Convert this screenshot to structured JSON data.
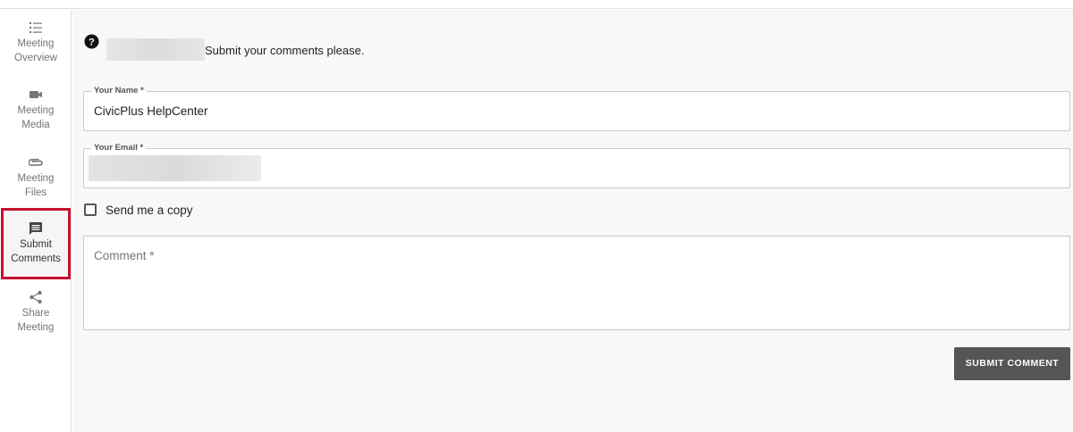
{
  "sidebar": {
    "items": [
      {
        "line1": "Meeting",
        "line2": "Overview",
        "icon": "list-icon"
      },
      {
        "line1": "Meeting",
        "line2": "Media",
        "icon": "video-camera-icon"
      },
      {
        "line1": "Meeting",
        "line2": "Files",
        "icon": "paperclip-icon"
      },
      {
        "line1": "Submit",
        "line2": "Comments",
        "icon": "comment-icon",
        "active": true
      },
      {
        "line1": "Share",
        "line2": "Meeting",
        "icon": "share-icon"
      }
    ]
  },
  "main": {
    "intro_text": "Submit your comments please.",
    "name_field": {
      "label": "Your Name *",
      "value": "CivicPlus HelpCenter"
    },
    "email_field": {
      "label": "Your Email *",
      "value": ""
    },
    "copy_checkbox": {
      "label": "Send me a copy",
      "checked": false
    },
    "comment_field": {
      "placeholder": "Comment *",
      "value": ""
    },
    "submit_label": "SUBMIT COMMENT"
  },
  "colors": {
    "highlight_border": "#c8102e",
    "button_bg": "#555555",
    "panel_bg": "#f8f8f8"
  }
}
